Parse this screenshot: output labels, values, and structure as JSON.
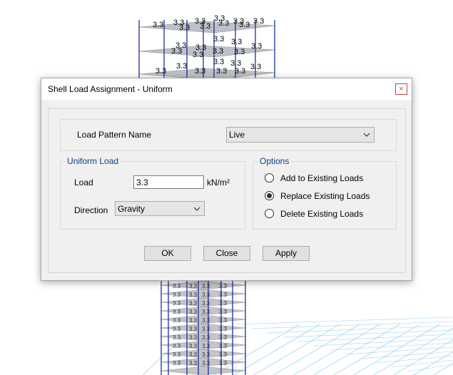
{
  "dialog": {
    "title": "Shell Load Assignment - Uniform",
    "close_glyph": "×"
  },
  "load_pattern": {
    "label": "Load Pattern Name",
    "value": "Live"
  },
  "uniform_load": {
    "legend": "Uniform Load",
    "load_label": "Load",
    "load_value": "3.3",
    "unit": "kN/m²",
    "direction_label": "Direction",
    "direction_value": "Gravity"
  },
  "options": {
    "legend": "Options",
    "items": [
      {
        "label": "Add to Existing Loads",
        "selected": false
      },
      {
        "label": "Replace Existing Loads",
        "selected": true
      },
      {
        "label": "Delete Existing Loads",
        "selected": false
      }
    ]
  },
  "buttons": {
    "ok": "OK",
    "close": "Close",
    "apply": "Apply"
  },
  "background": {
    "load_label": "3.3",
    "colors": {
      "frame": "#1d2f9a",
      "slab": "#b3b6be",
      "slab_edge": "#7a7e88",
      "grid": "#9fd3ec",
      "text": "#000000"
    }
  },
  "colors": {
    "accent": "#0a3f8a",
    "close_red": "#c9413b"
  }
}
